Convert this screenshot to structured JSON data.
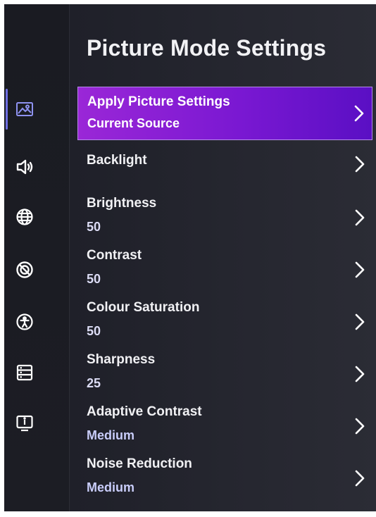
{
  "page": {
    "title": "Picture Mode Settings"
  },
  "sidebar": {
    "icons": [
      {
        "name": "picture-icon",
        "active": true
      },
      {
        "name": "sound-icon",
        "active": false
      },
      {
        "name": "network-globe-icon",
        "active": false
      },
      {
        "name": "no-disturb-icon",
        "active": false
      },
      {
        "name": "accessibility-icon",
        "active": false
      },
      {
        "name": "system-storage-icon",
        "active": false
      },
      {
        "name": "tv-info-icon",
        "active": false
      }
    ],
    "active_color": "#6e6ee0"
  },
  "menu": {
    "highlight_color": "#8a1fd6",
    "items": [
      {
        "label": "Apply Picture Settings",
        "value": "Current Source"
      },
      {
        "label": "Backlight",
        "value": ""
      },
      {
        "label": "Brightness",
        "value": "50"
      },
      {
        "label": "Contrast",
        "value": "50"
      },
      {
        "label": "Colour Saturation",
        "value": "50"
      },
      {
        "label": "Sharpness",
        "value": "25"
      },
      {
        "label": "Adaptive Contrast",
        "value": "Medium"
      },
      {
        "label": "Noise Reduction",
        "value": "Medium"
      }
    ]
  }
}
